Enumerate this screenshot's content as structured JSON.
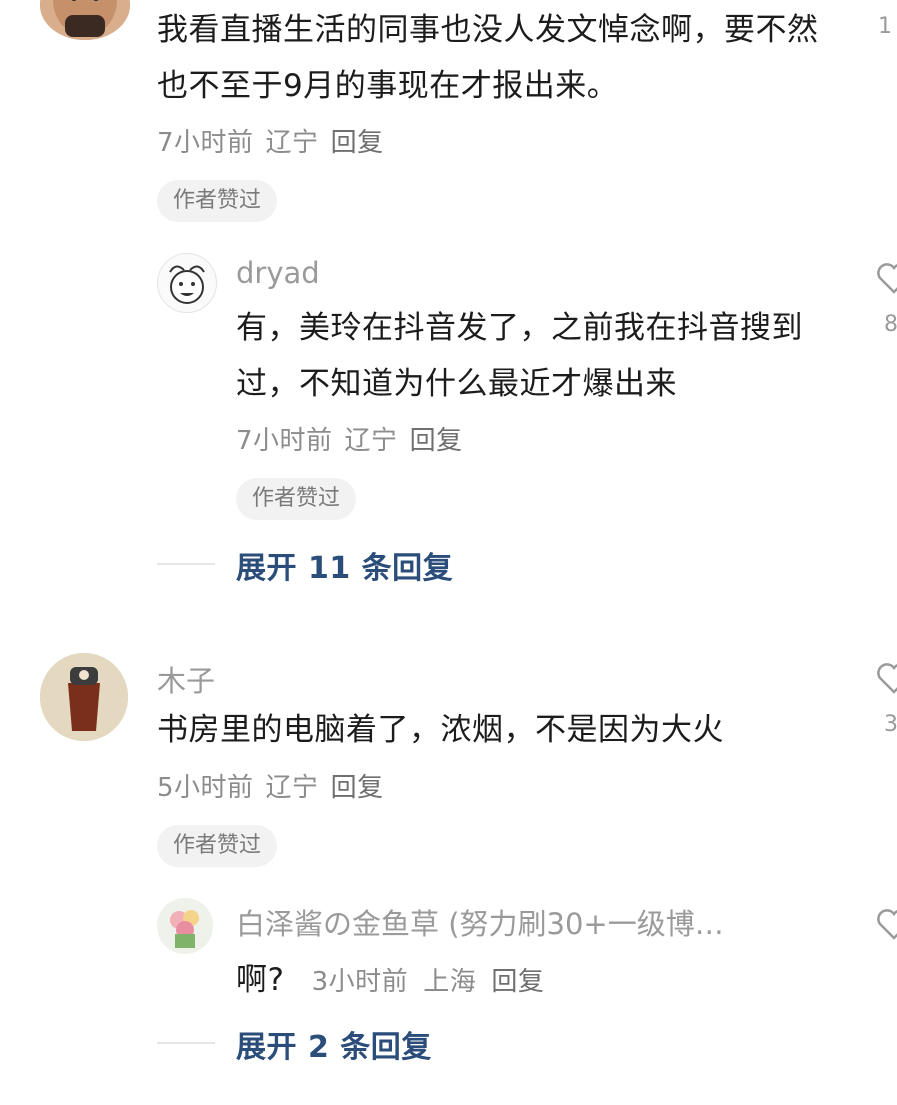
{
  "comments": [
    {
      "text": "我看直播生活的同事也没人发文悼念啊，要不然也不至于9月的事现在才报出来。",
      "time": "7小时前",
      "location": "辽宁",
      "reply": "回复",
      "badge": "作者赞过",
      "like_count": "1",
      "avatar_icon": "bald-man-avatar",
      "subreply": {
        "username": "dryad",
        "text": "有，美玲在抖音发了，之前我在抖音搜到过，不知道为什么最近才爆出来",
        "time": "7小时前",
        "location": "辽宁",
        "reply": "回复",
        "badge": "作者赞过",
        "like_count": "8",
        "avatar_icon": "cartoon-face-avatar"
      },
      "expand": "展开 11 条回复"
    },
    {
      "username": "木子",
      "text": "书房里的电脑着了，浓烟，不是因为大火",
      "time": "5小时前",
      "location": "辽宁",
      "reply": "回复",
      "badge": "作者赞过",
      "like_count": "3",
      "avatar_icon": "drink-cup-avatar",
      "subreply": {
        "username": "白泽酱の金鱼草 (努力刷30+一级博…",
        "text": "啊?",
        "time": "3小时前",
        "location": "上海",
        "reply": "回复",
        "avatar_icon": "flower-bouquet-avatar"
      },
      "expand": "展开 2 条回复"
    }
  ],
  "colors": {
    "link": "#2b4d7a",
    "meta": "#8c8c8c",
    "chip_bg": "#f2f2f2"
  }
}
